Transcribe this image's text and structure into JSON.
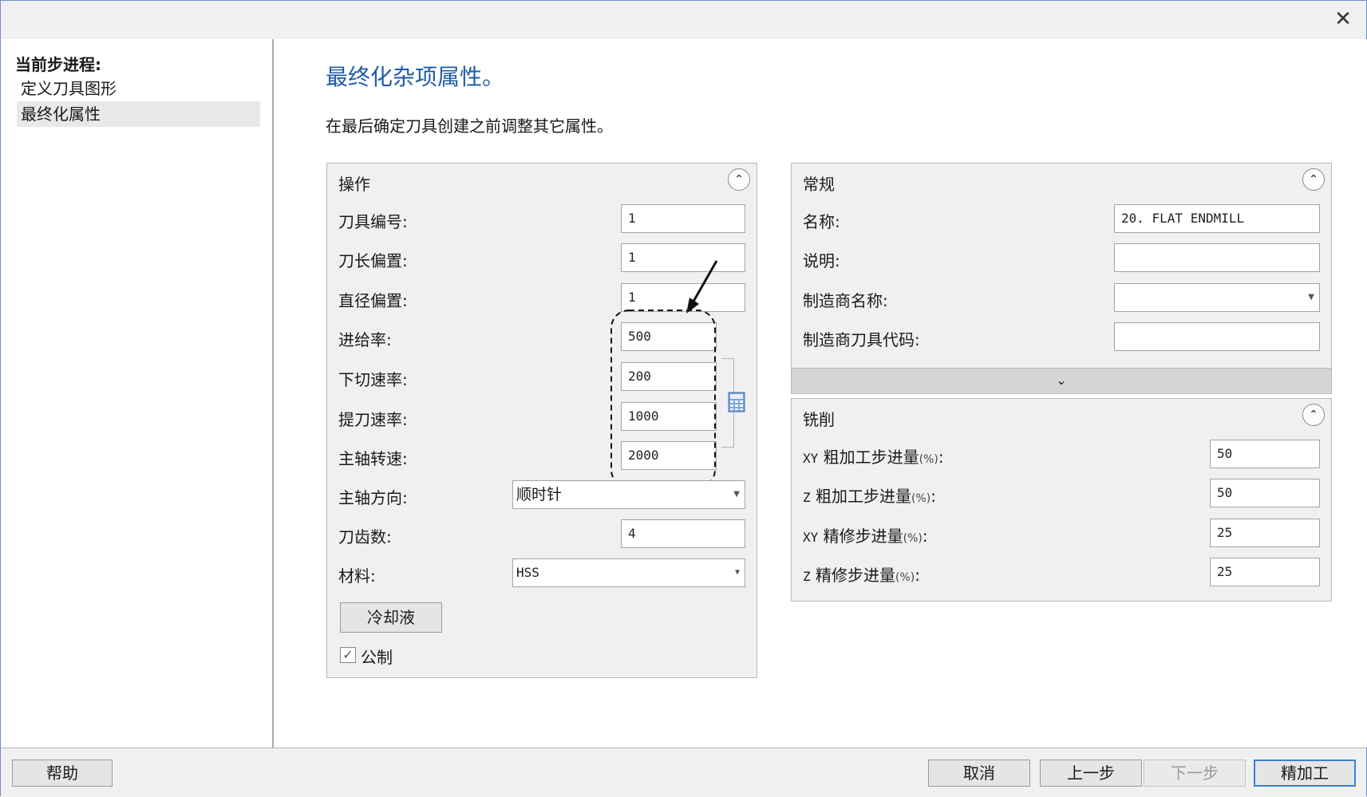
{
  "window": {
    "close_glyph": "✕"
  },
  "sidebar": {
    "heading": "当前步进程:",
    "items": [
      {
        "label": "定义刀具图形",
        "selected": false
      },
      {
        "label": "最终化属性",
        "selected": true
      }
    ]
  },
  "main": {
    "title": "最终化杂项属性。",
    "description": "在最后确定刀具创建之前调整其它属性。"
  },
  "operation": {
    "header": "操作",
    "collapse_icon": "chevron-up-icon",
    "tool_number": {
      "label": "刀具编号:",
      "value": "1"
    },
    "length_offset": {
      "label": "刀长偏置:",
      "value": "1"
    },
    "diameter_offset": {
      "label": "直径偏置:",
      "value": "1"
    },
    "feed_rate": {
      "label": "进给率:",
      "value": "500"
    },
    "plunge_rate": {
      "label": "下切速率:",
      "value": "200"
    },
    "retract_rate": {
      "label": "提刀速率:",
      "value": "1000"
    },
    "spindle_speed": {
      "label": "主轴转速:",
      "value": "2000"
    },
    "spindle_direction": {
      "label": "主轴方向:",
      "value": "顺时针"
    },
    "flute_count": {
      "label": "刀齿数:",
      "value": "4"
    },
    "material": {
      "label": "材料:",
      "value": "HSS"
    },
    "coolant_button": "冷却液",
    "metric": {
      "label": "公制",
      "checked": true
    }
  },
  "general": {
    "header": "常规",
    "name": {
      "label": "名称:",
      "value": "20. FLAT ENDMILL"
    },
    "description": {
      "label": "说明:",
      "value": ""
    },
    "manufacturer_name": {
      "label": "制造商名称:",
      "value": ""
    },
    "manufacturer_tool_code": {
      "label": "制造商刀具代码:",
      "value": ""
    },
    "expand_icon": "chevron-down-icon"
  },
  "milling": {
    "header": "铣削",
    "xy_rough": {
      "prefix": "XY",
      "label": "粗加工步进量",
      "unit": "(%)",
      "colon": ":",
      "value": "50"
    },
    "z_rough": {
      "prefix": "Z",
      "label": "粗加工步进量",
      "unit": "(%)",
      "colon": ":",
      "value": "50"
    },
    "xy_finish": {
      "prefix": "XY",
      "label": "精修步进量",
      "unit": "(%)",
      "colon": ":",
      "value": "25"
    },
    "z_finish": {
      "prefix": "Z",
      "label": "精修步进量",
      "unit": "(%)",
      "colon": ":",
      "value": "25"
    }
  },
  "footer": {
    "help": "帮助",
    "cancel": "取消",
    "back": "上一步",
    "next": "下一步",
    "finish": "精加工"
  },
  "colors": {
    "accent": "#1f5ca8",
    "window_border": "#6d8fc4",
    "panel_bg": "#f0f0f0"
  }
}
